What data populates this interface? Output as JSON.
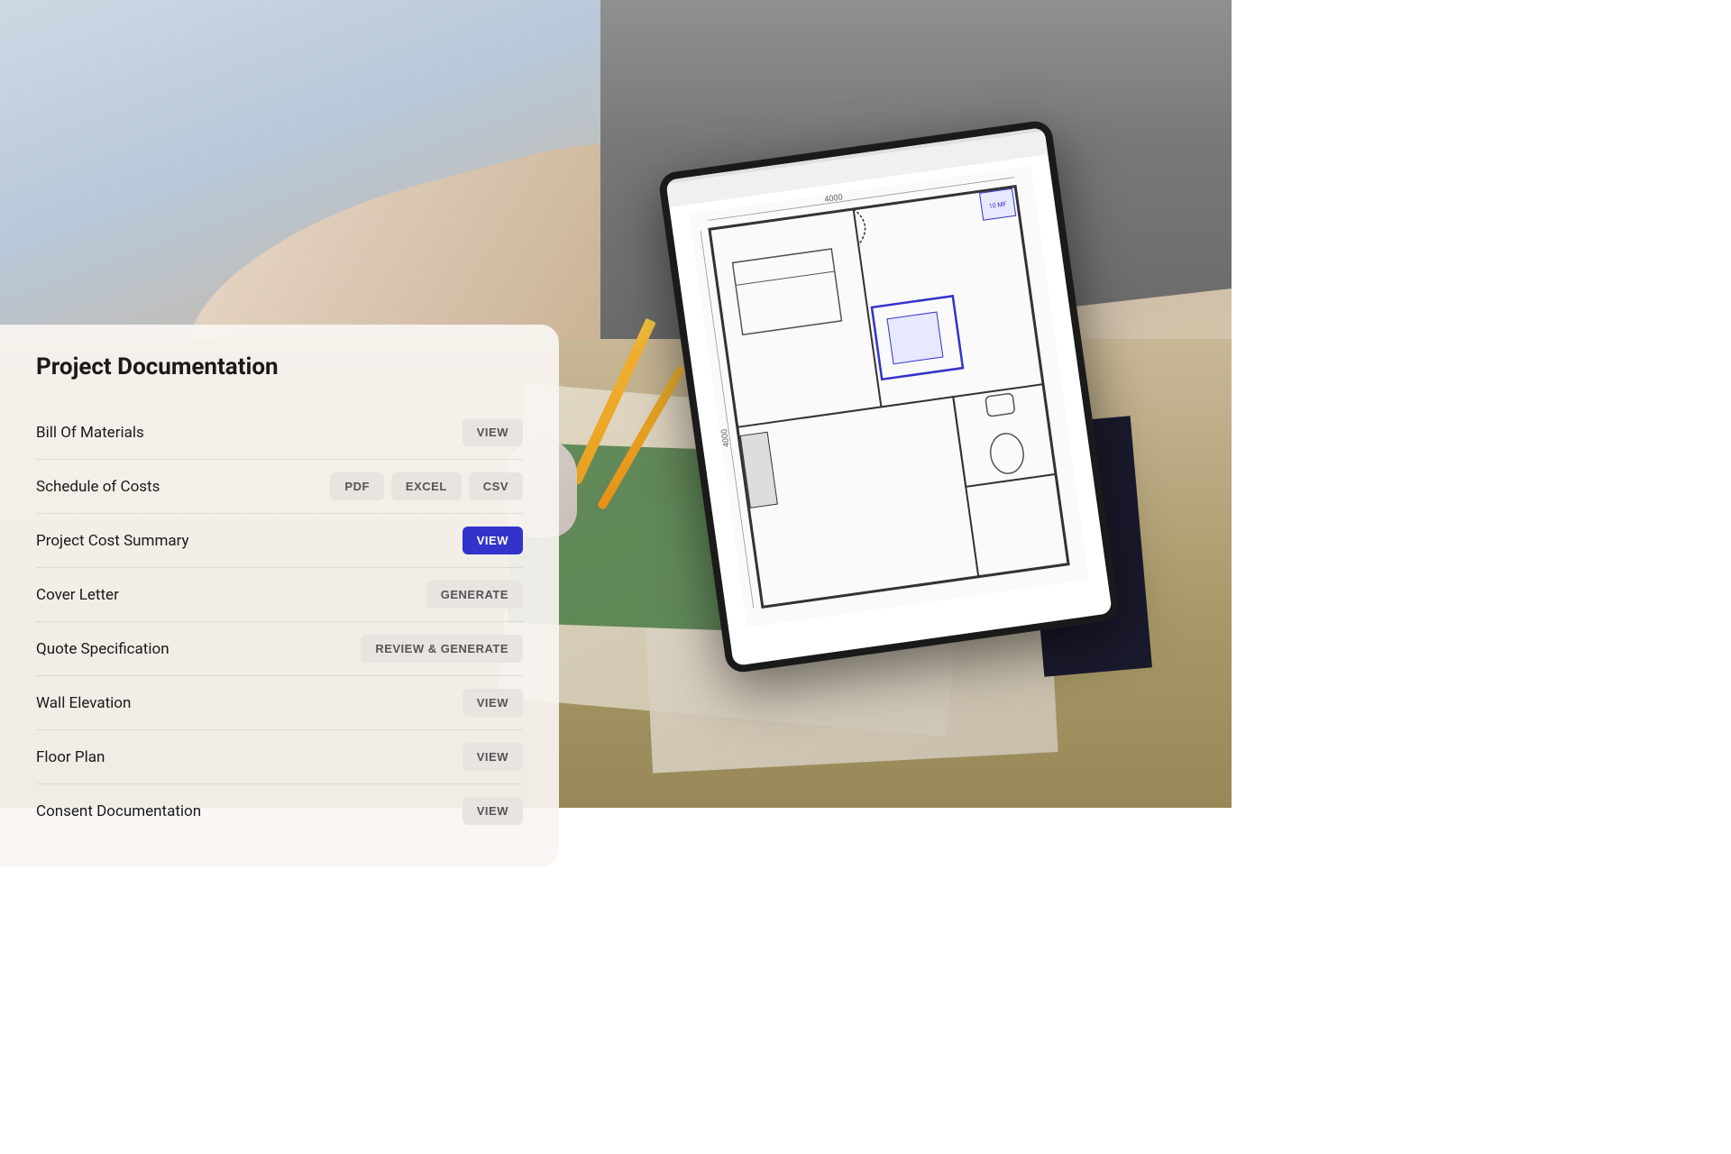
{
  "panel": {
    "title": "Project Documentation",
    "items": [
      {
        "id": "bill-of-materials",
        "label": "Bill Of Materials",
        "buttons": [
          {
            "id": "view",
            "label": "VIEW",
            "style": "default"
          }
        ]
      },
      {
        "id": "schedule-of-costs",
        "label": "Schedule of Costs",
        "buttons": [
          {
            "id": "pdf",
            "label": "PDF",
            "style": "default"
          },
          {
            "id": "excel",
            "label": "EXCEL",
            "style": "default"
          },
          {
            "id": "csv",
            "label": "CSV",
            "style": "default"
          }
        ]
      },
      {
        "id": "project-cost-summary",
        "label": "Project Cost Summary",
        "buttons": [
          {
            "id": "view",
            "label": "VIEW",
            "style": "primary"
          }
        ]
      },
      {
        "id": "cover-letter",
        "label": "Cover Letter",
        "buttons": [
          {
            "id": "generate",
            "label": "GENERATE",
            "style": "default"
          }
        ]
      },
      {
        "id": "quote-specification",
        "label": "Quote Specification",
        "buttons": [
          {
            "id": "review-generate",
            "label": "REVIEW & GENERATE",
            "style": "default"
          }
        ]
      },
      {
        "id": "wall-elevation",
        "label": "Wall Elevation",
        "buttons": [
          {
            "id": "view",
            "label": "VIEW",
            "style": "default"
          }
        ]
      },
      {
        "id": "floor-plan",
        "label": "Floor Plan",
        "buttons": [
          {
            "id": "view",
            "label": "VIEW",
            "style": "default"
          }
        ]
      },
      {
        "id": "consent-documentation",
        "label": "Consent Documentation",
        "buttons": [
          {
            "id": "view",
            "label": "VIEW",
            "style": "default"
          }
        ]
      }
    ]
  },
  "colors": {
    "primary_button_bg": "#3333cc",
    "default_button_bg": "#e8e4e0",
    "panel_bg": "rgba(248,245,242,0.92)"
  }
}
